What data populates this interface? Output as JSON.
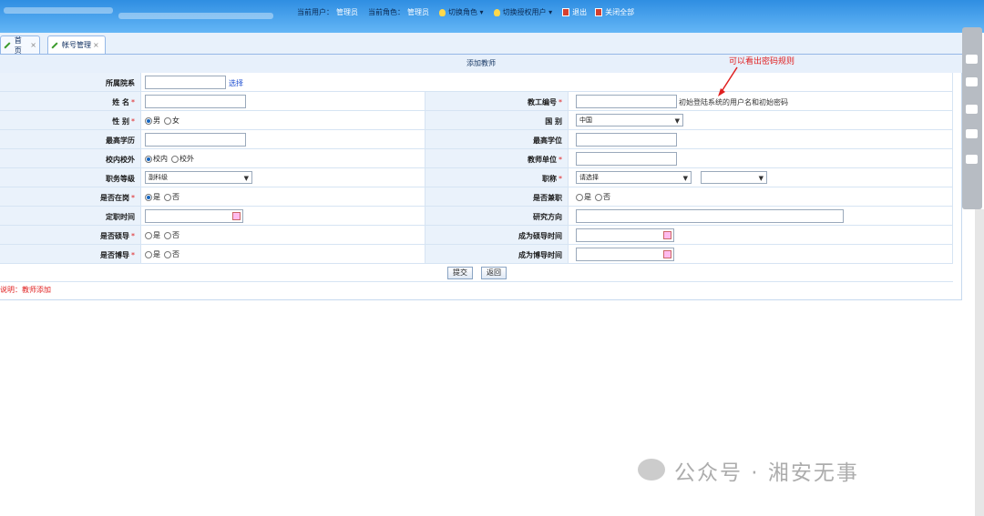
{
  "header": {
    "current_user_label": "当前用户：",
    "current_user": "管理员",
    "current_role_label": "当前角色：",
    "current_role": "管理员",
    "switch_role": "切换角色",
    "switch_auth_user": "切换授权用户",
    "logout": "退出",
    "close_all": "关闭全部"
  },
  "tabs": [
    {
      "label": "首页"
    },
    {
      "label": "帐号管理"
    }
  ],
  "form": {
    "title": "添加教师",
    "fields": {
      "department_label": "所属院系",
      "department_select_link": "选择",
      "name_label": "姓 名",
      "staff_no_label": "教工编号",
      "staff_no_hint": "初始登陆系统的用户名和初始密码",
      "gender_label": "性 别",
      "gender_male": "男",
      "gender_female": "女",
      "nationality_label": "国 别",
      "nationality_value": "中国",
      "education_label": "最高学历",
      "degree_label": "最高学位",
      "campus_label": "校内校外",
      "campus_in": "校内",
      "campus_out": "校外",
      "teacher_unit_label": "教师单位",
      "job_level_label": "职务等级",
      "job_level_value": "副科级",
      "title_label": "职称",
      "title_value": "请选择",
      "on_duty_label": "是否在岗",
      "yes": "是",
      "no": "否",
      "part_time_label": "是否兼职",
      "appoint_time_label": "定职时间",
      "research_label": "研究方向",
      "supervisor_label": "是否硕导",
      "supervisor_time_label": "成为硕导时间",
      "tutor_label": "是否博导",
      "tutor_time_label": "成为博导时间"
    },
    "submit": "提交",
    "back": "返回",
    "note": "说明：教师添加"
  },
  "annotation": "可以看出密码规则",
  "watermark": "公众号 · 湘安无事"
}
